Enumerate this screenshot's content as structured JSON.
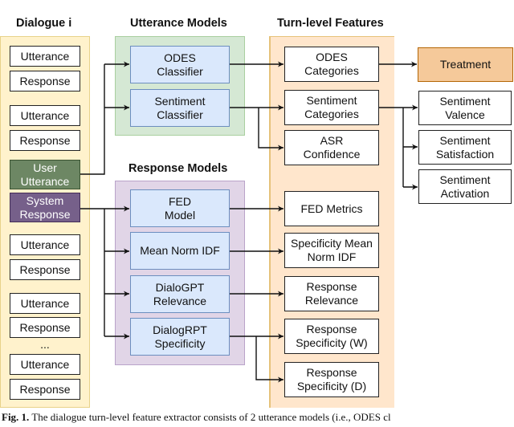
{
  "titles": {
    "dialogue": "Dialogue i",
    "utterance_models": "Utterance Models",
    "response_models": "Response Models",
    "turn_features": "Turn-level Features"
  },
  "dialogue": {
    "items": [
      "Utterance",
      "Response",
      "Utterance",
      "Response",
      "User\nUtterance",
      "System\nResponse",
      "Utterance",
      "Response",
      "Utterance",
      "Response",
      "...",
      "Utterance",
      "Response"
    ]
  },
  "utterance_models": [
    "ODES\nClassifier",
    "Sentiment\nClassifier"
  ],
  "response_models": [
    "FED\nModel",
    "Mean Norm IDF",
    "DialoGPT\nRelevance",
    "DialogRPT\nSpecificity"
  ],
  "features": [
    "ODES\nCategories",
    "Sentiment\nCategories",
    "ASR\nConfidence",
    "FED Metrics",
    "Specificity Mean\nNorm IDF",
    "Response\nRelevance",
    "Response\nSpecificity (W)",
    "Response\nSpecificity (D)"
  ],
  "outputs": {
    "treatment": "Treatment",
    "sentiment": [
      "Sentiment\nValence",
      "Sentiment\nSatisfaction",
      "Sentiment\nActivation"
    ]
  },
  "caption": {
    "label": "Fig. 1.",
    "text": " The dialogue turn-level feature extractor consists of 2 utterance models (i.e., ODES cl"
  },
  "colors": {
    "dialogue_group": "#fff2cc",
    "utterance_group": "#d5e8d4",
    "response_group": "#e1d5e7",
    "features_group": "#ffe6cc",
    "model_node": "#dae8fc",
    "user_utterance": "#6d8764",
    "system_response": "#76608a",
    "treatment": "#f5c99a"
  }
}
